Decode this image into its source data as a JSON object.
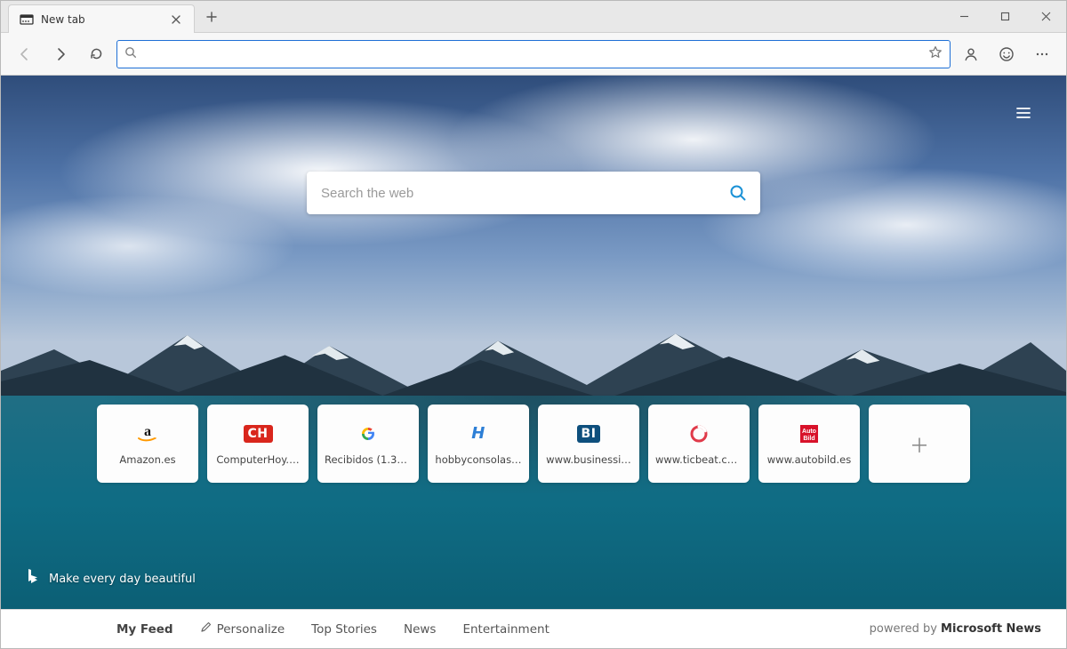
{
  "window": {
    "tab_title": "New tab"
  },
  "toolbar": {
    "url": ""
  },
  "ntp": {
    "search_placeholder": "Search the web",
    "bing_tagline": "Make every day beautiful",
    "tiles": [
      {
        "label": "Amazon.es",
        "icon": "amazon"
      },
      {
        "label": "ComputerHoy.…",
        "icon": "ch"
      },
      {
        "label": "Recibidos (1.33…",
        "icon": "google"
      },
      {
        "label": "hobbyconsolas…",
        "icon": "hobby"
      },
      {
        "label": "www.businessi…",
        "icon": "bi"
      },
      {
        "label": "www.ticbeat.co…",
        "icon": "ticbeat"
      },
      {
        "label": "www.autobild.es",
        "icon": "autobild"
      }
    ]
  },
  "newsbar": {
    "feed": "My Feed",
    "personalize": "Personalize",
    "top_stories": "Top Stories",
    "news": "News",
    "entertainment": "Entertainment",
    "powered_prefix": "powered by",
    "powered_brand": "Microsoft News"
  }
}
